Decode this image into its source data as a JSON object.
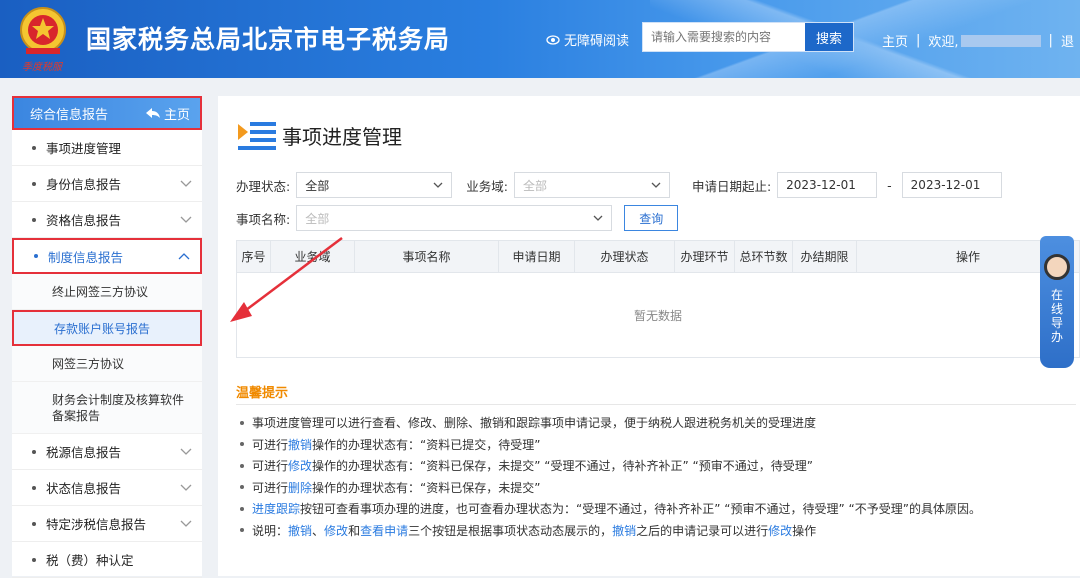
{
  "header": {
    "title": "国家税务总局北京市电子税务局",
    "emblem_text": "季度税服",
    "accessibility": "无障碍阅读",
    "search_placeholder": "请输入需要搜索的内容",
    "search_button": "搜索",
    "nav_home": "主页",
    "welcome": "欢迎,",
    "nav_more": "退"
  },
  "sidebar": {
    "head_label": "综合信息报告",
    "head_home": "主页",
    "items": [
      {
        "label": "事项进度管理"
      },
      {
        "label": "身份信息报告"
      },
      {
        "label": "资格信息报告"
      },
      {
        "label": "制度信息报告"
      },
      {
        "label": "税源信息报告"
      },
      {
        "label": "状态信息报告"
      },
      {
        "label": "特定涉税信息报告"
      },
      {
        "label": "税（费）种认定"
      }
    ],
    "subitems": [
      {
        "label": "终止网签三方协议"
      },
      {
        "label": "存款账户账号报告"
      },
      {
        "label": "网签三方协议"
      },
      {
        "label": "财务会计制度及核算软件备案报告"
      }
    ]
  },
  "main": {
    "title": "事项进度管理",
    "form": {
      "status_label": "办理状态:",
      "status_value": "全部",
      "domain_label": "业务域:",
      "domain_placeholder": "全部",
      "date_label": "申请日期起止:",
      "date_start": "2023-12-01",
      "date_sep": "-",
      "date_end": "2023-12-01",
      "item_label": "事项名称:",
      "item_placeholder": "全部",
      "query_button": "查询"
    },
    "table": {
      "columns": [
        "序号",
        "业务域",
        "事项名称",
        "申请日期",
        "办理状态",
        "办理环节",
        "总环节数",
        "办结期限",
        "操作"
      ],
      "empty_text": "暂无数据"
    },
    "tips": {
      "title": "温馨提示",
      "lines": [
        {
          "pre": "事项进度管理可以进行查看、修改、删除、撤销和跟踪事项申请记录，便于纳税人跟进税务机关的受理进度",
          "link": "",
          "post": ""
        },
        {
          "pre": "可进行",
          "link": "撤销",
          "post": "操作的办理状态有：“资料已提交，待受理”"
        },
        {
          "pre": "可进行",
          "link": "修改",
          "post": "操作的办理状态有：“资料已保存，未提交” “受理不通过，待补齐补正” “预审不通过，待受理”"
        },
        {
          "pre": "可进行",
          "link": "删除",
          "post": "操作的办理状态有：“资料已保存，未提交”"
        },
        {
          "pre": "",
          "link": "进度跟踪",
          "post": "按钮可查看事项办理的进度，也可查看办理状态为：“受理不通过，待补齐补正” “预审不通过，待受理” “不予受理”的具体原因。"
        }
      ],
      "last_line": {
        "p1": "说明：",
        "l1": "撤销",
        "p2": "、",
        "l2": "修改",
        "p3": "和",
        "l3": "查看申请",
        "p4": "三个按钮是根据事项状态动态展示的，",
        "l4": "撤销",
        "p5": "之后的申请记录可以进行",
        "l5": "修改",
        "p6": "操作"
      }
    }
  },
  "guide": {
    "label": "在线导办"
  },
  "colors": {
    "accent": "#2a6fd0",
    "highlight_border": "#e5303a",
    "tips_title": "#f08a00"
  }
}
